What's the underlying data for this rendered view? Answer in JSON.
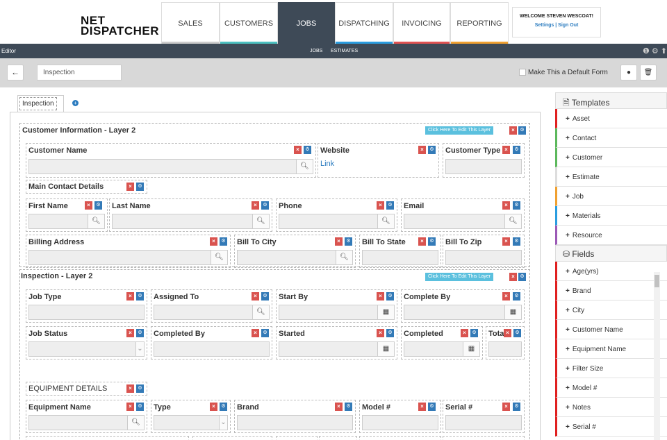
{
  "app": {
    "logo": "NET\nDISPATCHER"
  },
  "nav": {
    "tabs": [
      {
        "label": "SALES",
        "color": "#cccccc"
      },
      {
        "label": "CUSTOMERS",
        "color": "#4bc0c0"
      },
      {
        "label": "JOBS",
        "color": "#3e4a57",
        "active": true
      },
      {
        "label": "DISPATCHING",
        "color": "#2a9de0"
      },
      {
        "label": "INVOICING",
        "color": "#e05252"
      },
      {
        "label": "REPORTING",
        "color": "#f0a030"
      }
    ],
    "welcome": "WELCOME STEVEN WESCOAT!",
    "links": "Settings | Sign Out"
  },
  "subbar": {
    "left": "Editor",
    "items": [
      "JOBS",
      "ESTIMATES"
    ]
  },
  "toolbar": {
    "back": "←",
    "form_name": "Inspection",
    "default_label": "Make This a Default Form"
  },
  "form": {
    "tab": "Inspection",
    "edit_layer": "Click Here To Edit This Layer",
    "layer1": "Customer Information - Layer 2",
    "layer2": "Inspection - Layer 2",
    "link": "Link",
    "fields": {
      "customer_name": "Customer Name",
      "website": "Website",
      "customer_type": "Customer Type",
      "main_contact": "Main Contact Details",
      "first_name": "First Name",
      "last_name": "Last Name",
      "phone": "Phone",
      "email": "Email",
      "billing_address": "Billing Address",
      "bill_city": "Bill To City",
      "bill_state": "Bill To State",
      "bill_zip": "Bill To Zip",
      "job_type": "Job Type",
      "assigned_to": "Assigned To",
      "start_by": "Start By",
      "complete_by": "Complete By",
      "job_status": "Job Status",
      "completed_by": "Completed By",
      "started": "Started",
      "completed": "Completed",
      "total": "Tota",
      "equipment_details": "EQUIPMENT DETAILS",
      "equipment_name": "Equipment Name",
      "type": "Type",
      "brand": "Brand",
      "model": "Model #",
      "serial": "Serial #"
    }
  },
  "sidebar": {
    "templates_title": "Templates",
    "templates": [
      {
        "label": "Asset",
        "color": "#e02020"
      },
      {
        "label": "Contact",
        "color": "#5cb85c"
      },
      {
        "label": "Customer",
        "color": "#5cb85c"
      },
      {
        "label": "Estimate",
        "color": "#dddddd"
      },
      {
        "label": "Job",
        "color": "#f0a030"
      },
      {
        "label": "Materials",
        "color": "#2a9de0"
      },
      {
        "label": "Resource",
        "color": "#9b59b6"
      }
    ],
    "fields_title": "Fields",
    "fields": [
      "Age(yrs)",
      "Brand",
      "City",
      "Customer Name",
      "Equipment Name",
      "Filter Size",
      "Model #",
      "Notes",
      "Serial #"
    ]
  }
}
